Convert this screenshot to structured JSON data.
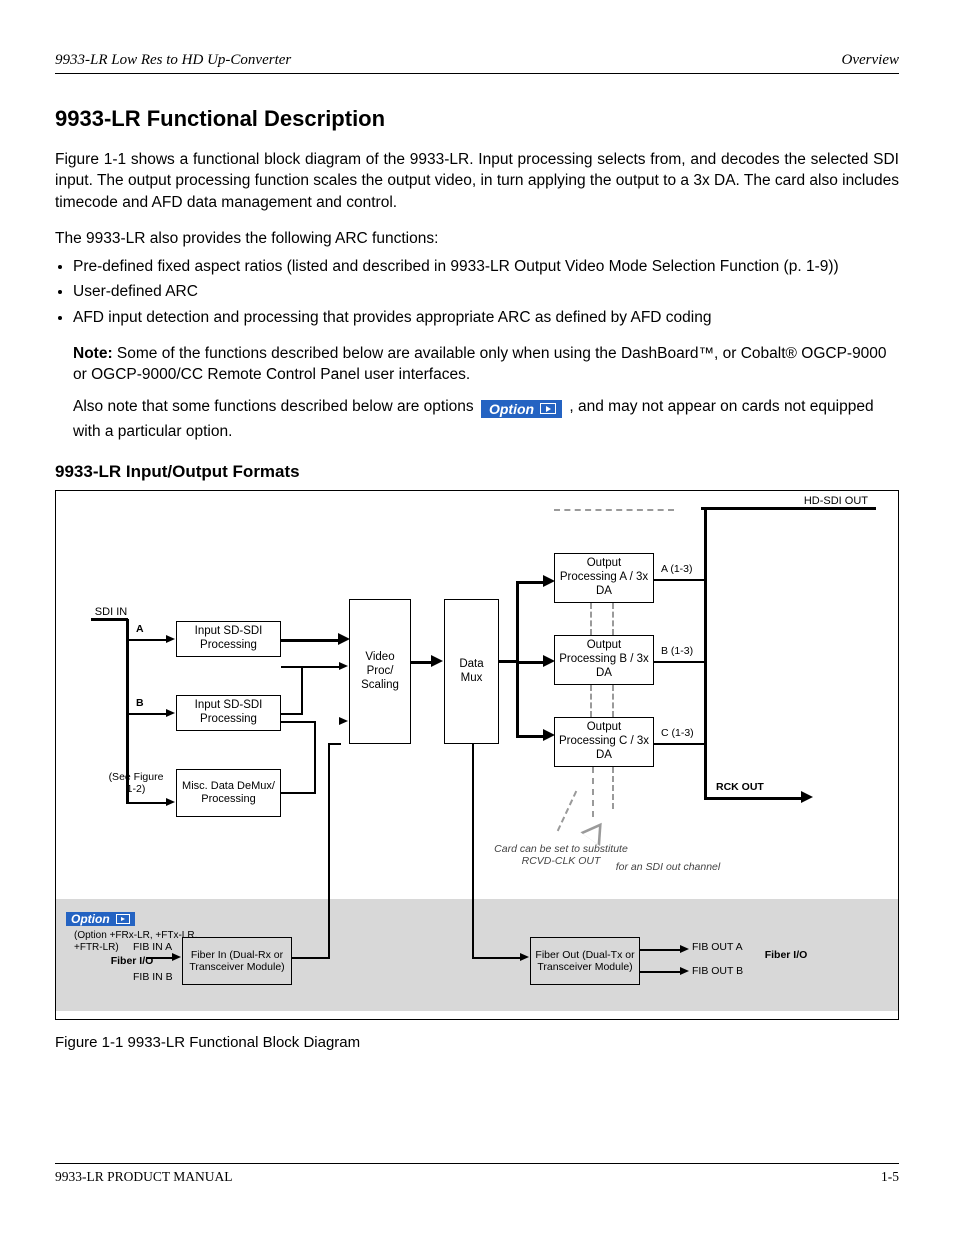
{
  "header": {
    "left": "9933-LR Low Res to HD Up-Converter",
    "right": "Overview"
  },
  "section": {
    "heading": "9933-LR Functional Description",
    "p1": "Figure 1-1 shows a functional block diagram of the 9933-LR. Input processing selects from, and decodes the selected SDI input. The output processing function scales the output video, in turn applying the output to a 3x DA. The card also includes timecode and AFD data management and control.",
    "bullet_intro": "The 9933-LR also provides the following ARC functions:",
    "bullets": [
      "Pre-defined fixed aspect ratios (listed and described in 9933-LR Output Video Mode Selection Function (p. 1-9))",
      "User-defined ARC",
      "AFD input detection and processing that provides appropriate ARC as defined by AFD coding"
    ],
    "note_label": "Note:",
    "note_text": "Some of the functions described below are available only when using the DashBoard™, or Cobalt® OGCP-9000 or OGCP-9000/CC Remote Control Panel user interfaces.",
    "note2": "Also note that some functions described below are options , and may not appear on cards not equipped with a particular option."
  },
  "option_badge": {
    "text": "Option",
    "icon": "arrow-in-box-icon"
  },
  "subheading": "9933-LR Input/Output Formats",
  "figure": {
    "caption": "Figure 1-1  9933-LR Functional Block Diagram",
    "inputs": {
      "bus": "SDI IN",
      "a": "A",
      "b": "B",
      "misc": "(See Figure 1-2)"
    },
    "blocks": {
      "in_a": "Input SD-SDI Processing",
      "in_b": "Input SD-SDI Processing",
      "in_misc": "Misc. Data DeMux/ Processing",
      "proc": "Video Proc/ Scaling",
      "mux": "Data Mux",
      "out_a": "Output Processing A / 3x DA",
      "out_b": "Output Processing B / 3x DA",
      "out_c": "Output Processing C / 3x DA",
      "fiber_in": "Fiber In (Dual-Rx or Transceiver Module)",
      "fiber_out": "Fiber Out (Dual-Tx or Transceiver Module)"
    },
    "labels": {
      "out_bus": "HD-SDI OUT",
      "a1": "A (1-3)",
      "b1": "B (1-3)",
      "c1": "C (1-3)",
      "rclk": "RCK OUT",
      "fiber_label": "Fiber I/O",
      "fib_a": "FIB IN A",
      "fib_b": "FIB IN B",
      "fob_a": "FIB OUT A",
      "fob_b": "FIB OUT B"
    },
    "options": {
      "fiber": "(Option +FRx-LR, +FTx-LR, +FTR-LR)"
    },
    "annotations": {
      "rclk_txt1": "Card can be set to substitute RCVD-CLK OUT",
      "rclk_txt2": "for an SDI out channel"
    }
  },
  "footer": {
    "left": "9933-LR PRODUCT MANUAL",
    "right": "1-5"
  }
}
